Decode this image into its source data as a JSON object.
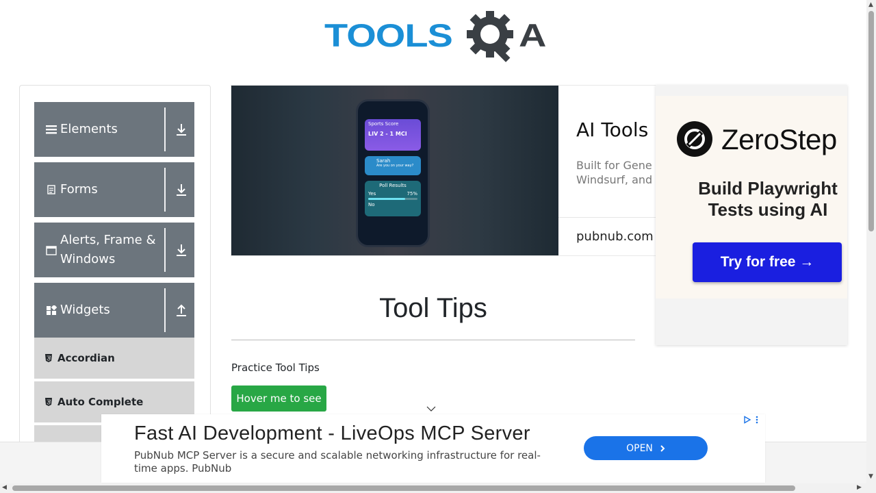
{
  "header": {
    "logo_text_left": "TOOLS",
    "logo_text_right": "A",
    "logo_colors": {
      "primary": "#1b8fd6",
      "dark": "#3a3f44"
    }
  },
  "sidebar": {
    "groups": [
      {
        "label": "Elements",
        "icon": "hamburger-icon",
        "state": "collapsed"
      },
      {
        "label": "Forms",
        "icon": "document-icon",
        "state": "collapsed"
      },
      {
        "label": "Alerts, Frame & Windows",
        "icon": "window-icon",
        "state": "collapsed"
      },
      {
        "label": "Widgets",
        "icon": "widgets-icon",
        "state": "expanded"
      }
    ],
    "sub_items": [
      {
        "label": "Accordian",
        "icon": "html5-icon"
      },
      {
        "label": "Auto Complete",
        "icon": "html5-icon"
      }
    ],
    "colors": {
      "group_bg": "#6c757d",
      "sub_bg": "#d6d6d6"
    }
  },
  "top_ad": {
    "phone": {
      "card1_title": "Sports Score",
      "card1_score": "LIV  2 - 1 MCI",
      "card2_name": "Sarah",
      "card2_msg": "Are you on your way?",
      "card3_title": "Poll Results",
      "card3_yes": "Yes",
      "card3_pct": "75%",
      "card3_no": "No",
      "poll_yes_fraction": 0.75
    },
    "title": "AI Tools",
    "description_line1": "Built for Gene",
    "description_line2": "Windsurf, and",
    "domain": "pubnub.com"
  },
  "right_ad": {
    "brand": "ZeroStep",
    "tagline_line1": "Build Playwright",
    "tagline_line2": "Tests using AI",
    "cta": "Try for free →",
    "cta_color": "#1a1fe0"
  },
  "main": {
    "page_title": "Tool Tips",
    "practice_label": "Practice Tool Tips",
    "hover_button": "Hover me to see",
    "hover_button_color": "#28a745"
  },
  "bottom_ad": {
    "title": "Fast AI Development - LiveOps MCP Server",
    "description": "PubNub MCP Server is a secure and scalable networking infrastructure for real-time apps. PubNub",
    "cta": "OPEN",
    "cta_color": "#1a73e8"
  }
}
